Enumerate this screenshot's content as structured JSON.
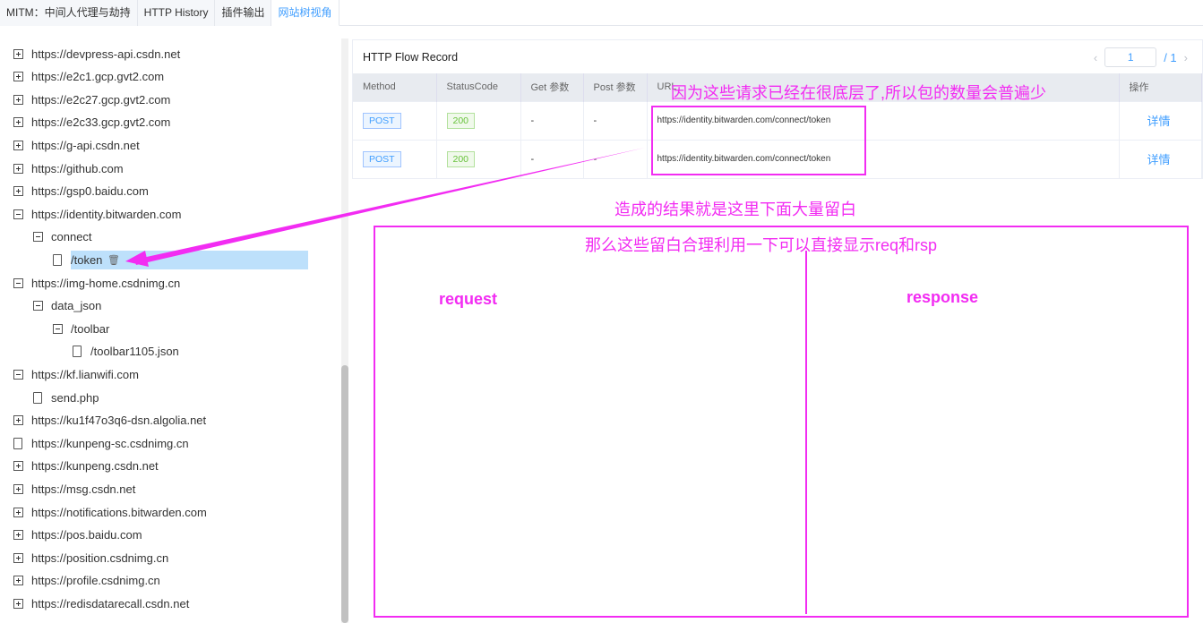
{
  "tabs": [
    "MITM：中间人代理与劫持",
    "HTTP History",
    "插件输出",
    "网站树视角"
  ],
  "active_tab": 3,
  "tree": [
    {
      "label": "https://devpress-api.csdn.net",
      "level": 0,
      "icon": "plus"
    },
    {
      "label": "https://e2c1.gcp.gvt2.com",
      "level": 0,
      "icon": "plus"
    },
    {
      "label": "https://e2c27.gcp.gvt2.com",
      "level": 0,
      "icon": "plus"
    },
    {
      "label": "https://e2c33.gcp.gvt2.com",
      "level": 0,
      "icon": "plus"
    },
    {
      "label": "https://g-api.csdn.net",
      "level": 0,
      "icon": "plus"
    },
    {
      "label": "https://github.com",
      "level": 0,
      "icon": "plus"
    },
    {
      "label": "https://gsp0.baidu.com",
      "level": 0,
      "icon": "plus"
    },
    {
      "label": "https://identity.bitwarden.com",
      "level": 0,
      "icon": "minus"
    },
    {
      "label": "connect",
      "level": 1,
      "icon": "minus"
    },
    {
      "label": "/token",
      "level": 2,
      "icon": "file",
      "selected": true,
      "trash": true
    },
    {
      "label": "https://img-home.csdnimg.cn",
      "level": 0,
      "icon": "minus"
    },
    {
      "label": "data_json",
      "level": 1,
      "icon": "minus"
    },
    {
      "label": "/toolbar",
      "level": 2,
      "icon": "minus"
    },
    {
      "label": "/toolbar1105.json",
      "level": 3,
      "icon": "file"
    },
    {
      "label": "https://kf.lianwifi.com",
      "level": 0,
      "icon": "minus"
    },
    {
      "label": "send.php",
      "level": 1,
      "icon": "file"
    },
    {
      "label": "https://ku1f47o3q6-dsn.algolia.net",
      "level": 0,
      "icon": "plus"
    },
    {
      "label": "https://kunpeng-sc.csdnimg.cn",
      "level": 0,
      "icon": "file"
    },
    {
      "label": "https://kunpeng.csdn.net",
      "level": 0,
      "icon": "plus"
    },
    {
      "label": "https://msg.csdn.net",
      "level": 0,
      "icon": "plus"
    },
    {
      "label": "https://notifications.bitwarden.com",
      "level": 0,
      "icon": "plus"
    },
    {
      "label": "https://pos.baidu.com",
      "level": 0,
      "icon": "plus"
    },
    {
      "label": "https://position.csdnimg.cn",
      "level": 0,
      "icon": "plus"
    },
    {
      "label": "https://profile.csdnimg.cn",
      "level": 0,
      "icon": "plus"
    },
    {
      "label": "https://redisdatarecall.csdn.net",
      "level": 0,
      "icon": "plus"
    }
  ],
  "panel": {
    "title": "HTTP Flow Record",
    "page": "1",
    "total": "/ 1",
    "columns": [
      "Method",
      "StatusCode",
      "Get 参数",
      "Post 参数",
      "URL",
      "操作"
    ],
    "rows": [
      {
        "method": "POST",
        "status": "200",
        "get": "-",
        "post": "-",
        "url": "https://identity.bitwarden.com/connect/token",
        "action": "详情"
      },
      {
        "method": "POST",
        "status": "200",
        "get": "-",
        "post": "-",
        "url": "https://identity.bitwarden.com/connect/token",
        "action": "详情"
      }
    ]
  },
  "annotations": {
    "note1": "因为这些请求已经在很底层了,所以包的数量会普遍少",
    "note2": "造成的结果就是这里下面大量留白",
    "note3": "那么这些留白合理利用一下可以直接显示req和rsp",
    "request": "request",
    "response": "response",
    "color": "#f22cf2"
  }
}
